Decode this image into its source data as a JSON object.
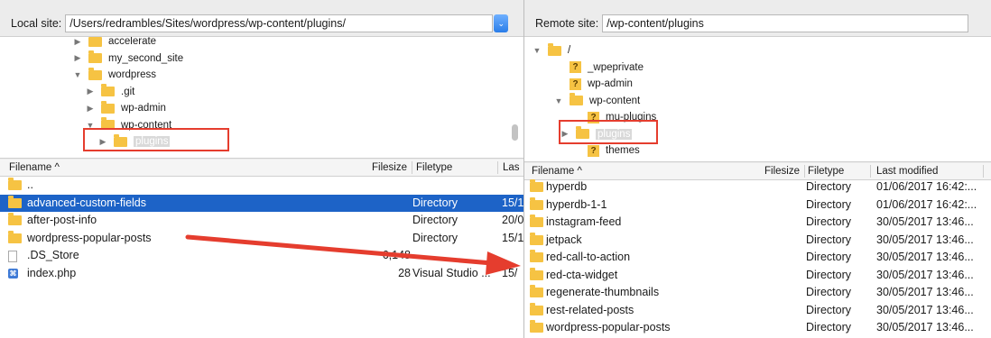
{
  "local": {
    "label": "Local site:",
    "path": "/Users/redrambles/Sites/wordpress/wp-content/plugins/",
    "combo_glyph": "⌄",
    "tree": [
      {
        "name": "accelerate",
        "expander": "▶",
        "icon": "folder"
      },
      {
        "name": "my_second_site",
        "expander": "▶",
        "icon": "folder"
      },
      {
        "name": "wordpress",
        "expander": "▼",
        "icon": "folder"
      },
      {
        "name": ".git",
        "expander": "▶",
        "icon": "folder"
      },
      {
        "name": "wp-admin",
        "expander": "▶",
        "icon": "folder"
      },
      {
        "name": "wp-content",
        "expander": "▼",
        "icon": "folder"
      },
      {
        "name": "plugins",
        "expander": "▶",
        "icon": "folder",
        "selected": true
      }
    ],
    "columns": {
      "filename": "Filename ^",
      "filesize": "Filesize",
      "filetype": "Filetype",
      "last_modified": "Las"
    },
    "files": [
      {
        "name": "..",
        "icon": "folder",
        "size": "",
        "type": "",
        "modified": ""
      },
      {
        "name": "advanced-custom-fields",
        "icon": "folder",
        "size": "",
        "type": "Directory",
        "modified": "15/1",
        "selected": true
      },
      {
        "name": "after-post-info",
        "icon": "folder",
        "size": "",
        "type": "Directory",
        "modified": "20/0"
      },
      {
        "name": "wordpress-popular-posts",
        "icon": "folder",
        "size": "",
        "type": "Directory",
        "modified": "15/1"
      },
      {
        "name": ".DS_Store",
        "icon": "file",
        "size": "6,148",
        "type": "",
        "modified": ""
      },
      {
        "name": "index.php",
        "icon": "vscode",
        "size": "28",
        "type": "Visual Studio ...",
        "modified": "15/"
      }
    ]
  },
  "remote": {
    "label": "Remote site:",
    "path": "/wp-content/plugins",
    "tree": [
      {
        "name": "/",
        "expander": "▼",
        "icon": "folder"
      },
      {
        "name": "_wpeprivate",
        "expander": "",
        "icon": "question"
      },
      {
        "name": "wp-admin",
        "expander": "",
        "icon": "question"
      },
      {
        "name": "wp-content",
        "expander": "▼",
        "icon": "folder"
      },
      {
        "name": "mu-plugins",
        "expander": "",
        "icon": "question"
      },
      {
        "name": "plugins",
        "expander": "▶",
        "icon": "folder",
        "selected": true
      },
      {
        "name": "themes",
        "expander": "",
        "icon": "question"
      }
    ],
    "columns": {
      "filename": "Filename ^",
      "filesize": "Filesize",
      "filetype": "Filetype",
      "last_modified": "Last modified"
    },
    "files": [
      {
        "name": "hyperdb",
        "icon": "folder",
        "type": "Directory",
        "modified": "01/06/2017 16:42:..."
      },
      {
        "name": "hyperdb-1-1",
        "icon": "folder",
        "type": "Directory",
        "modified": "01/06/2017 16:42:..."
      },
      {
        "name": "instagram-feed",
        "icon": "folder",
        "type": "Directory",
        "modified": "30/05/2017 13:46..."
      },
      {
        "name": "jetpack",
        "icon": "folder",
        "type": "Directory",
        "modified": "30/05/2017 13:46..."
      },
      {
        "name": "red-call-to-action",
        "icon": "folder",
        "type": "Directory",
        "modified": "30/05/2017 13:46..."
      },
      {
        "name": "red-cta-widget",
        "icon": "folder",
        "type": "Directory",
        "modified": "30/05/2017 13:46..."
      },
      {
        "name": "regenerate-thumbnails",
        "icon": "folder",
        "type": "Directory",
        "modified": "30/05/2017 13:46..."
      },
      {
        "name": "rest-related-posts",
        "icon": "folder",
        "type": "Directory",
        "modified": "30/05/2017 13:46..."
      },
      {
        "name": "wordpress-popular-posts",
        "icon": "folder",
        "type": "Directory",
        "modified": "30/05/2017 13:46..."
      }
    ]
  },
  "annotation": {
    "color": "#e53d2e"
  }
}
